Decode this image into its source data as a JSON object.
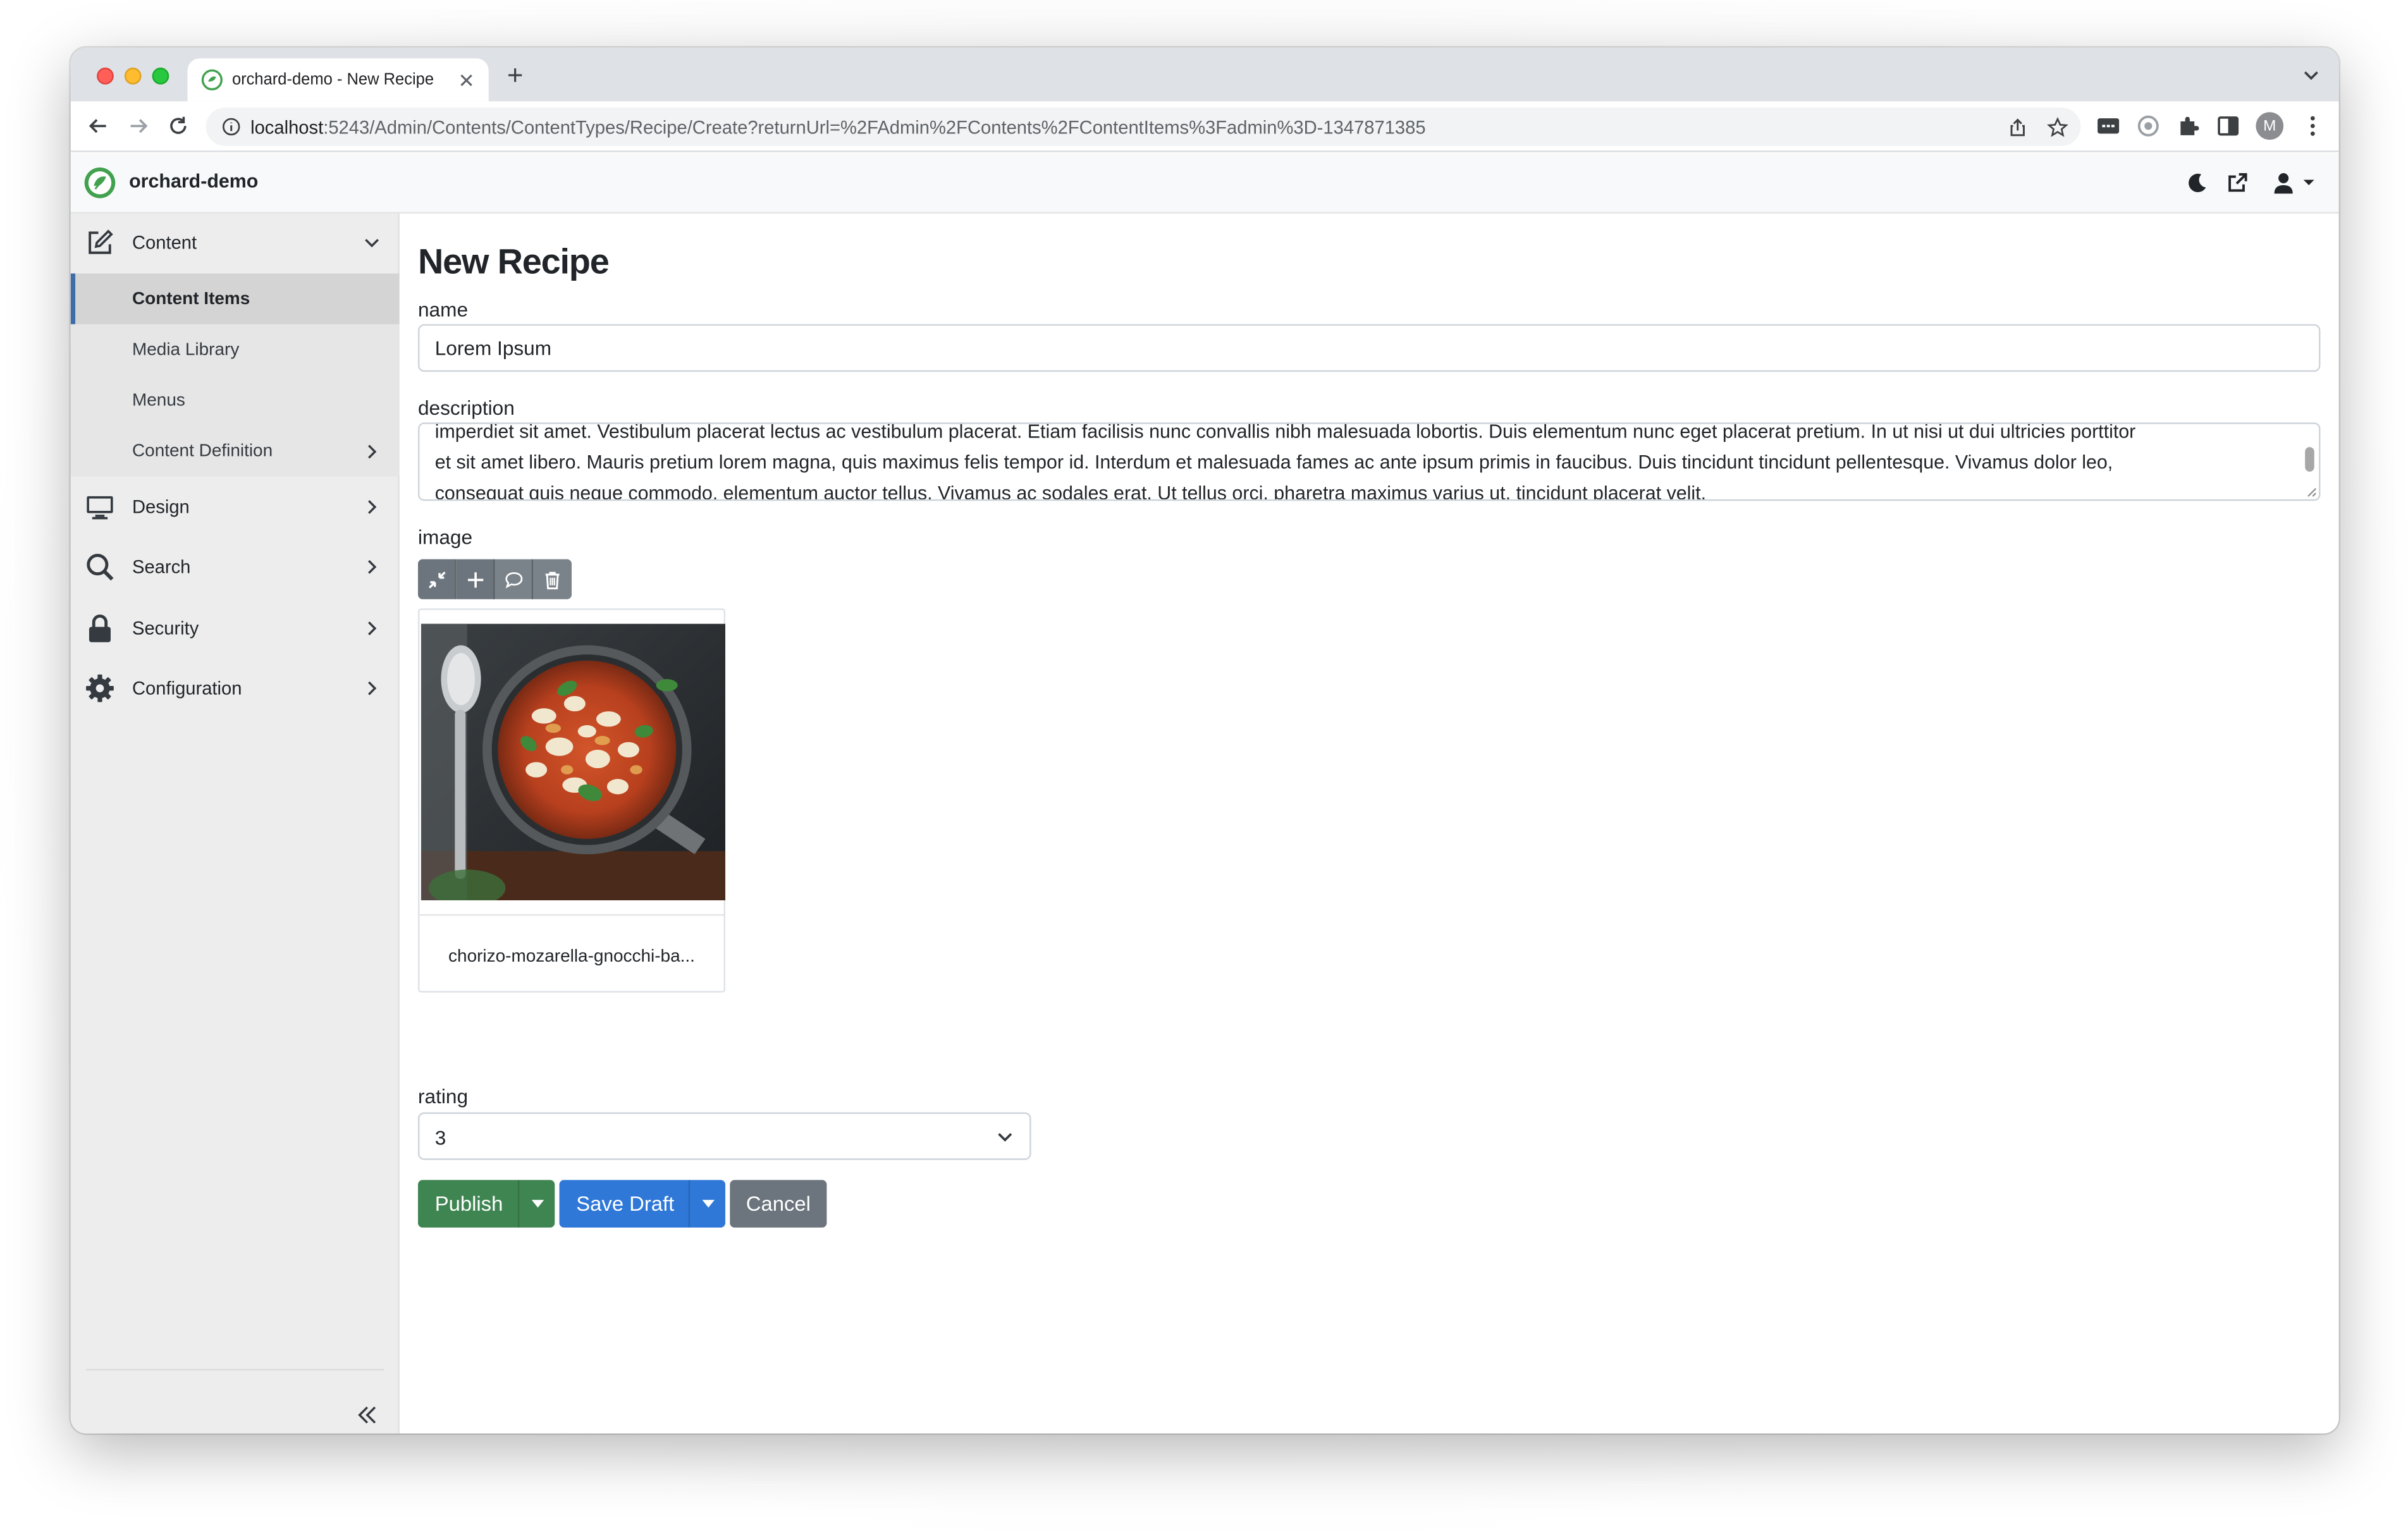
{
  "browser": {
    "tab_title": "orchard-demo - New Recipe",
    "url_host": "localhost",
    "url_path": ":5243/Admin/Contents/ContentTypes/Recipe/Create?returnUrl=%2FAdmin%2FContents%2FContentItems%3Fadmin%3D-1347871385",
    "profile_initial": "M"
  },
  "app": {
    "brand": "orchard-demo"
  },
  "sidebar": {
    "sections": [
      {
        "label": "Content",
        "icon": "edit-icon",
        "expanded": true
      },
      {
        "label": "Design",
        "icon": "monitor-icon"
      },
      {
        "label": "Search",
        "icon": "search-icon"
      },
      {
        "label": "Security",
        "icon": "lock-icon"
      },
      {
        "label": "Configuration",
        "icon": "gear-icon"
      }
    ],
    "content_items": [
      {
        "label": "Content Items",
        "active": true
      },
      {
        "label": "Media Library"
      },
      {
        "label": "Menus"
      },
      {
        "label": "Content Definition"
      }
    ]
  },
  "form": {
    "title": "New Recipe",
    "name_label": "name",
    "name_value": "Lorem Ipsum",
    "description_label": "description",
    "description_lines": [
      "imperdiet sit amet. Vestibulum placerat lectus ac vestibulum placerat. Etiam facilisis nunc convallis nibh malesuada lobortis. Duis elementum nunc eget placerat pretium. In ut nisi ut dui ultricies porttitor",
      "et sit amet libero. Mauris pretium lorem magna, quis maximus felis tempor id. Interdum et malesuada fames ac ante ipsum primis in faucibus. Duis tincidunt tincidunt pellentesque. Vivamus dolor leo,",
      "consequat quis neque commodo, elementum auctor tellus. Vivamus ac sodales erat. Ut tellus orci, pharetra maximus varius ut, tincidunt placerat velit."
    ],
    "image_label": "image",
    "image_filename": "chorizo-mozarella-gnocchi-ba...",
    "rating_label": "rating",
    "rating_value": "3"
  },
  "actions": {
    "publish": "Publish",
    "save_draft": "Save Draft",
    "cancel": "Cancel"
  },
  "colors": {
    "publish": "#3f8552",
    "save_draft": "#2f78d8",
    "cancel": "#6c757d",
    "active_accent": "#3f6da8"
  }
}
